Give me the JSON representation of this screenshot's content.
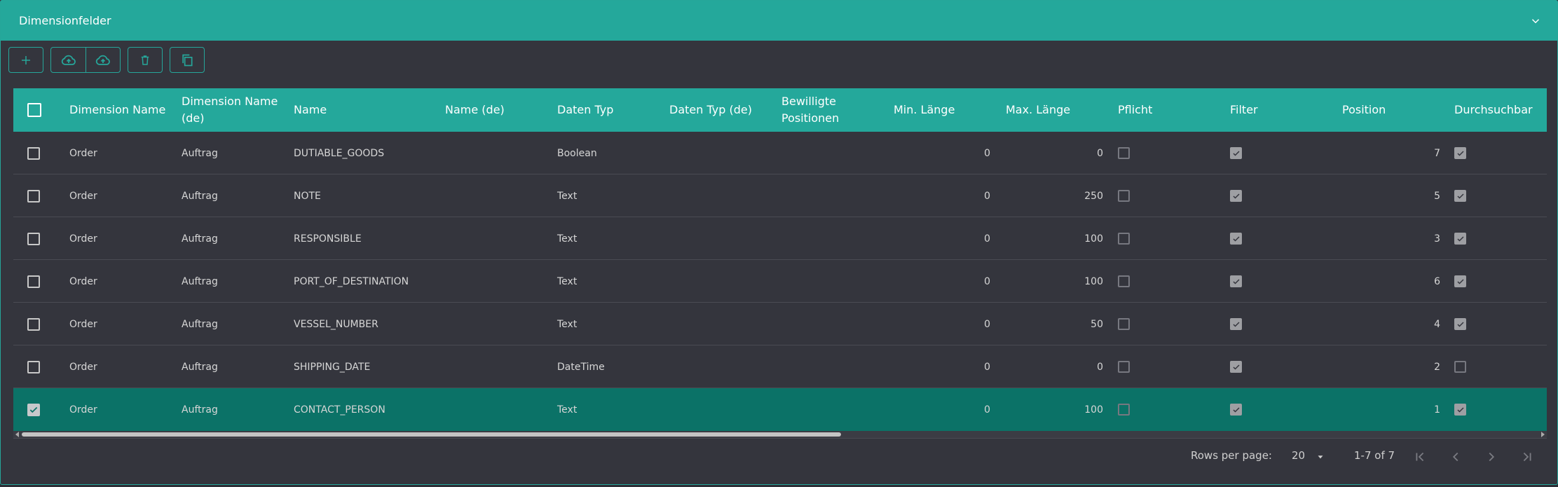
{
  "panel": {
    "title": "Dimensionfelder"
  },
  "toolbar": {
    "add": "add-icon",
    "upload1": "cloud-upload-icon",
    "upload2": "cloud-upload-icon",
    "delete": "trash-icon",
    "copy": "copy-icon"
  },
  "table": {
    "columns": {
      "dimension_name": "Dimension Name",
      "dimension_name_de": "Dimension Name (de)",
      "name": "Name",
      "name_de": "Name (de)",
      "daten_typ": "Daten Typ",
      "daten_typ_de": "Daten Typ (de)",
      "bewilligte_positionen": "Bewilligte Positionen",
      "min_laenge": "Min. Länge",
      "max_laenge": "Max. Länge",
      "pflicht": "Pflicht",
      "filter": "Filter",
      "position": "Position",
      "durchsuchbar": "Durchsuchbar"
    },
    "rows": [
      {
        "selected": false,
        "dimension_name": "Order",
        "dimension_name_de": "Auftrag",
        "name": "DUTIABLE_GOODS",
        "name_de": "",
        "daten_typ": "Boolean",
        "daten_typ_de": "",
        "bewilligte_positionen": "",
        "min_laenge": "0",
        "max_laenge": "0",
        "pflicht": false,
        "filter": true,
        "position": "7",
        "durchsuchbar": true
      },
      {
        "selected": false,
        "dimension_name": "Order",
        "dimension_name_de": "Auftrag",
        "name": "NOTE",
        "name_de": "",
        "daten_typ": "Text",
        "daten_typ_de": "",
        "bewilligte_positionen": "",
        "min_laenge": "0",
        "max_laenge": "250",
        "pflicht": false,
        "filter": true,
        "position": "5",
        "durchsuchbar": true
      },
      {
        "selected": false,
        "dimension_name": "Order",
        "dimension_name_de": "Auftrag",
        "name": "RESPONSIBLE",
        "name_de": "",
        "daten_typ": "Text",
        "daten_typ_de": "",
        "bewilligte_positionen": "",
        "min_laenge": "0",
        "max_laenge": "100",
        "pflicht": false,
        "filter": true,
        "position": "3",
        "durchsuchbar": true
      },
      {
        "selected": false,
        "dimension_name": "Order",
        "dimension_name_de": "Auftrag",
        "name": "PORT_OF_DESTINATION",
        "name_de": "",
        "daten_typ": "Text",
        "daten_typ_de": "",
        "bewilligte_positionen": "",
        "min_laenge": "0",
        "max_laenge": "100",
        "pflicht": false,
        "filter": true,
        "position": "6",
        "durchsuchbar": true
      },
      {
        "selected": false,
        "dimension_name": "Order",
        "dimension_name_de": "Auftrag",
        "name": "VESSEL_NUMBER",
        "name_de": "",
        "daten_typ": "Text",
        "daten_typ_de": "",
        "bewilligte_positionen": "",
        "min_laenge": "0",
        "max_laenge": "50",
        "pflicht": false,
        "filter": true,
        "position": "4",
        "durchsuchbar": true
      },
      {
        "selected": false,
        "dimension_name": "Order",
        "dimension_name_de": "Auftrag",
        "name": "SHIPPING_DATE",
        "name_de": "",
        "daten_typ": "DateTime",
        "daten_typ_de": "",
        "bewilligte_positionen": "",
        "min_laenge": "0",
        "max_laenge": "0",
        "pflicht": false,
        "filter": true,
        "position": "2",
        "durchsuchbar": false
      },
      {
        "selected": true,
        "dimension_name": "Order",
        "dimension_name_de": "Auftrag",
        "name": "CONTACT_PERSON",
        "name_de": "",
        "daten_typ": "Text",
        "daten_typ_de": "",
        "bewilligte_positionen": "",
        "min_laenge": "0",
        "max_laenge": "100",
        "pflicht": false,
        "filter": true,
        "position": "1",
        "durchsuchbar": true
      }
    ]
  },
  "pagination": {
    "rows_per_page_label": "Rows per page:",
    "rows_per_page_value": "20",
    "range": "1-7 of 7"
  },
  "colors": {
    "accent": "#24a89b",
    "selected_row": "#0b7267",
    "background": "#34353d"
  }
}
